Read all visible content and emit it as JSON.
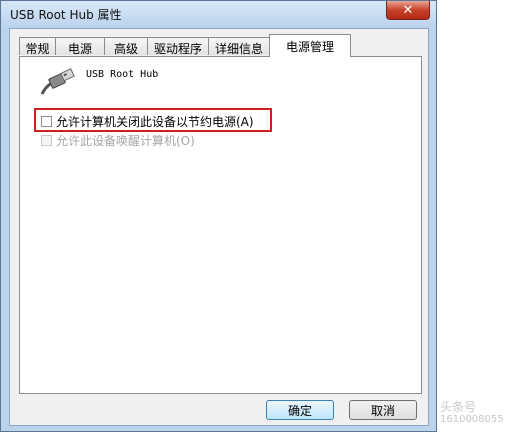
{
  "window": {
    "title": "USB Root Hub 属性",
    "close_glyph": "✕"
  },
  "tabs": [
    {
      "label": "常规"
    },
    {
      "label": "电源"
    },
    {
      "label": "高级"
    },
    {
      "label": "驱动程序"
    },
    {
      "label": "详细信息"
    },
    {
      "label": "电源管理",
      "active": true
    }
  ],
  "device": {
    "name": "USB Root Hub",
    "icon": "usb-cable-icon"
  },
  "options": {
    "allow_off": {
      "label": "允许计算机关闭此设备以节约电源(A)",
      "checked": false
    },
    "allow_wake": {
      "label": "允许此设备唤醒计算机(O)",
      "checked": false,
      "disabled": true
    }
  },
  "buttons": {
    "ok": "确定",
    "cancel": "取消"
  },
  "watermark": {
    "line1": "头条号",
    "line2": "1610008055"
  },
  "colors": {
    "highlight_border": "#d21e1e",
    "titlebar": "#bcd3ec",
    "close_button": "#c8412b"
  }
}
